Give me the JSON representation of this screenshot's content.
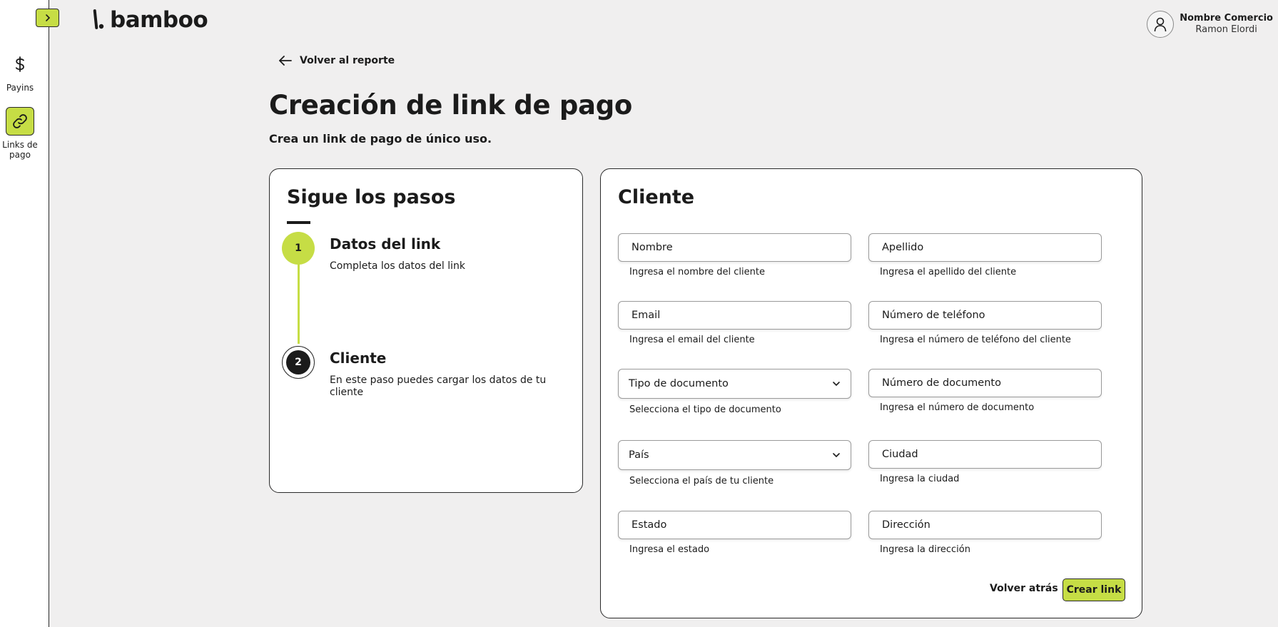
{
  "brand": {
    "name": "bamboo",
    "accent_color": "#c6dd45"
  },
  "sidebar": {
    "toggle_icon": "chevron-right-icon",
    "items": [
      {
        "label": "Payins",
        "icon": "dollar-icon",
        "active": false
      },
      {
        "label": "Links de pago",
        "icon": "link-icon",
        "active": true
      }
    ]
  },
  "header": {
    "user": {
      "company": "Nombre Comercio",
      "name": "Ramon Elordi",
      "icon": "user-icon"
    }
  },
  "main": {
    "back_label": "Volver al reporte",
    "title": "Creación de link de pago",
    "subtitle": "Crea un link de pago de único uso."
  },
  "steps": {
    "title": "Sigue los pasos",
    "items": [
      {
        "number": "1",
        "title": "Datos del link",
        "description": "Completa los datos del link",
        "state": "completed"
      },
      {
        "number": "2",
        "title": "Cliente",
        "description": "En este paso puedes cargar los datos de tu cliente",
        "state": "current"
      }
    ]
  },
  "client_form": {
    "title": "Cliente",
    "fields": {
      "nombre": {
        "placeholder": "Nombre",
        "hint": "Ingresa el nombre del cliente"
      },
      "apellido": {
        "placeholder": "Apellido",
        "hint": "Ingresa el apellido del cliente"
      },
      "email": {
        "placeholder": "Email",
        "hint": "Ingresa el email del cliente"
      },
      "telefono": {
        "placeholder": "Número de teléfono",
        "hint": "Ingresa el número de teléfono del cliente"
      },
      "tipo_documento": {
        "placeholder": "Tipo de documento",
        "hint": "Selecciona el tipo de documento"
      },
      "numero_documento": {
        "placeholder": "Número de documento",
        "hint": "Ingresa el número de documento"
      },
      "pais": {
        "placeholder": "País",
        "hint": "Selecciona el país de tu cliente"
      },
      "ciudad": {
        "placeholder": "Ciudad",
        "hint": "Ingresa la ciudad"
      },
      "estado": {
        "placeholder": "Estado",
        "hint": "Ingresa el estado"
      },
      "direccion": {
        "placeholder": "Dirección",
        "hint": "Ingresa la dirección"
      }
    },
    "actions": {
      "back_label": "Volver atrás",
      "create_label": "Crear link"
    }
  }
}
